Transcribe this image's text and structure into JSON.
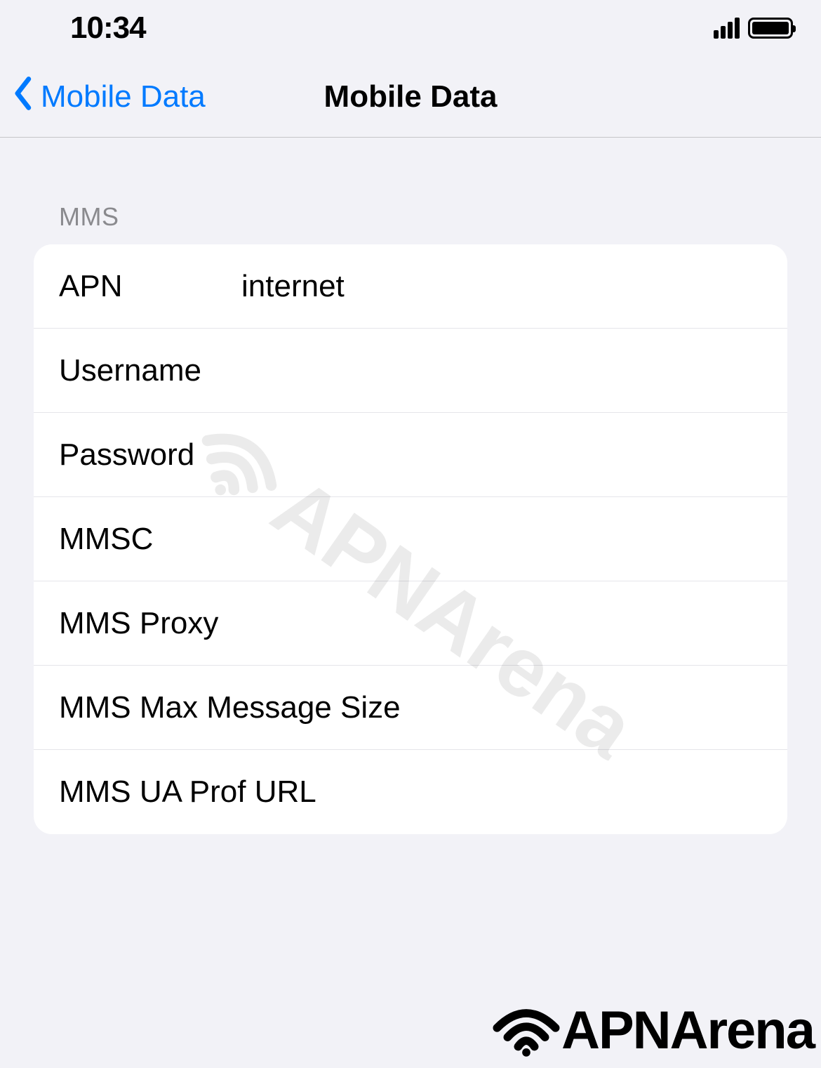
{
  "status_bar": {
    "time": "10:34"
  },
  "nav": {
    "back_label": "Mobile Data",
    "title": "Mobile Data"
  },
  "section": {
    "header": "MMS",
    "rows": [
      {
        "label": "APN",
        "value": "internet"
      },
      {
        "label": "Username",
        "value": ""
      },
      {
        "label": "Password",
        "value": ""
      },
      {
        "label": "MMSC",
        "value": ""
      },
      {
        "label": "MMS Proxy",
        "value": ""
      },
      {
        "label": "MMS Max Message Size",
        "value": ""
      },
      {
        "label": "MMS UA Prof URL",
        "value": ""
      }
    ]
  },
  "watermark": {
    "text": "APNArena"
  },
  "footer": {
    "brand": "APNArena"
  }
}
